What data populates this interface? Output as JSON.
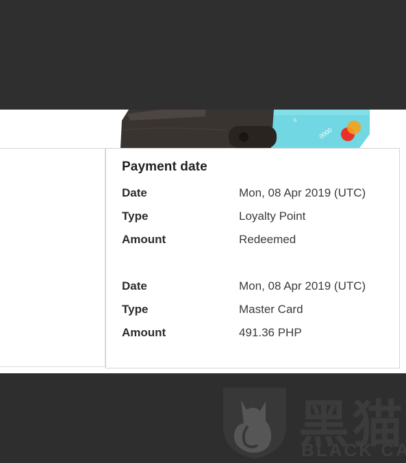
{
  "payment": {
    "title": "Payment date",
    "entries": [
      {
        "date_label": "Date",
        "date_value": "Mon, 08 Apr 2019 (UTC)",
        "type_label": "Type",
        "type_value": "Loyalty Point",
        "amount_label": "Amount",
        "amount_value": "Redeemed"
      },
      {
        "date_label": "Date",
        "date_value": "Mon, 08 Apr 2019 (UTC)",
        "type_label": "Type",
        "type_value": "Master Card",
        "amount_label": "Amount",
        "amount_value": "491.36 PHP"
      }
    ]
  },
  "hero": {
    "icons": [
      "wallet-icon",
      "credit-card-icon",
      "mastercard-logo-icon"
    ]
  },
  "watermark": {
    "cn_text": "黑猫",
    "en_text": "BLACK CAT",
    "icon": "black-cat-logo-icon"
  },
  "colors": {
    "background_dark": "#2e2e2e",
    "card_color": "#6fd6e0",
    "mastercard_red": "#e9302a",
    "mastercard_orange": "#f5a21b"
  }
}
